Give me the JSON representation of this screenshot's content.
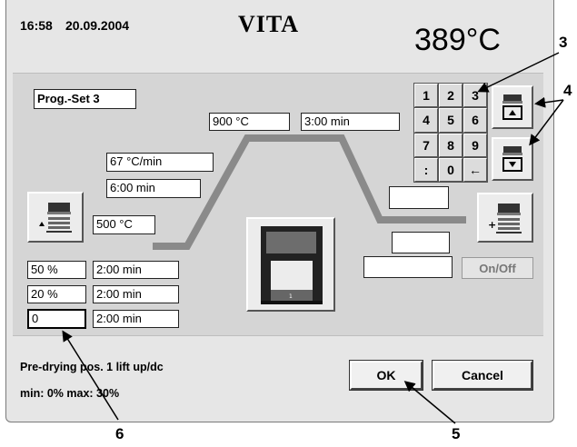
{
  "header": {
    "time": "16:58",
    "date": "20.09.2004",
    "brand": "VITA",
    "current_temp": "389°C"
  },
  "program": {
    "set_label": "Prog.-Set 3"
  },
  "firing_curve": {
    "hold_temp": "900 °C",
    "hold_time": "3:00 min",
    "heat_rate": "67 °C/min",
    "heat_time": "6:00 min",
    "start_temp": "500 °C",
    "cool_field_1": "",
    "cool_field_2": "",
    "cool_field_3": ""
  },
  "predrying": {
    "rows": [
      {
        "percent": "50 %",
        "time": "2:00 min"
      },
      {
        "percent": "20 %",
        "time": "2:00 min"
      },
      {
        "percent": "0",
        "time": "2:00 min"
      }
    ]
  },
  "keypad": {
    "keys": [
      "1",
      "2",
      "3",
      "4",
      "5",
      "6",
      "7",
      "8",
      "9",
      ":",
      "0",
      "←"
    ]
  },
  "buttons": {
    "onoff": "On/Off",
    "ok": "OK",
    "cancel": "Cancel"
  },
  "status": {
    "line1": "Pre-drying pos. 1 lift up/dc",
    "line2": "min: 0% max: 30%"
  },
  "callouts": {
    "c3": "3",
    "c4": "4",
    "c5": "5",
    "c6": "6"
  },
  "colors": {
    "curve": "#8a8a8a",
    "panel": "#d5d5d5",
    "frame": "#e6e6e6"
  },
  "icons": [
    "lift-up-icon",
    "lift-down-icon",
    "furnace-lower-icon",
    "furnace-raise-icon",
    "furnace-chamber-icon"
  ]
}
